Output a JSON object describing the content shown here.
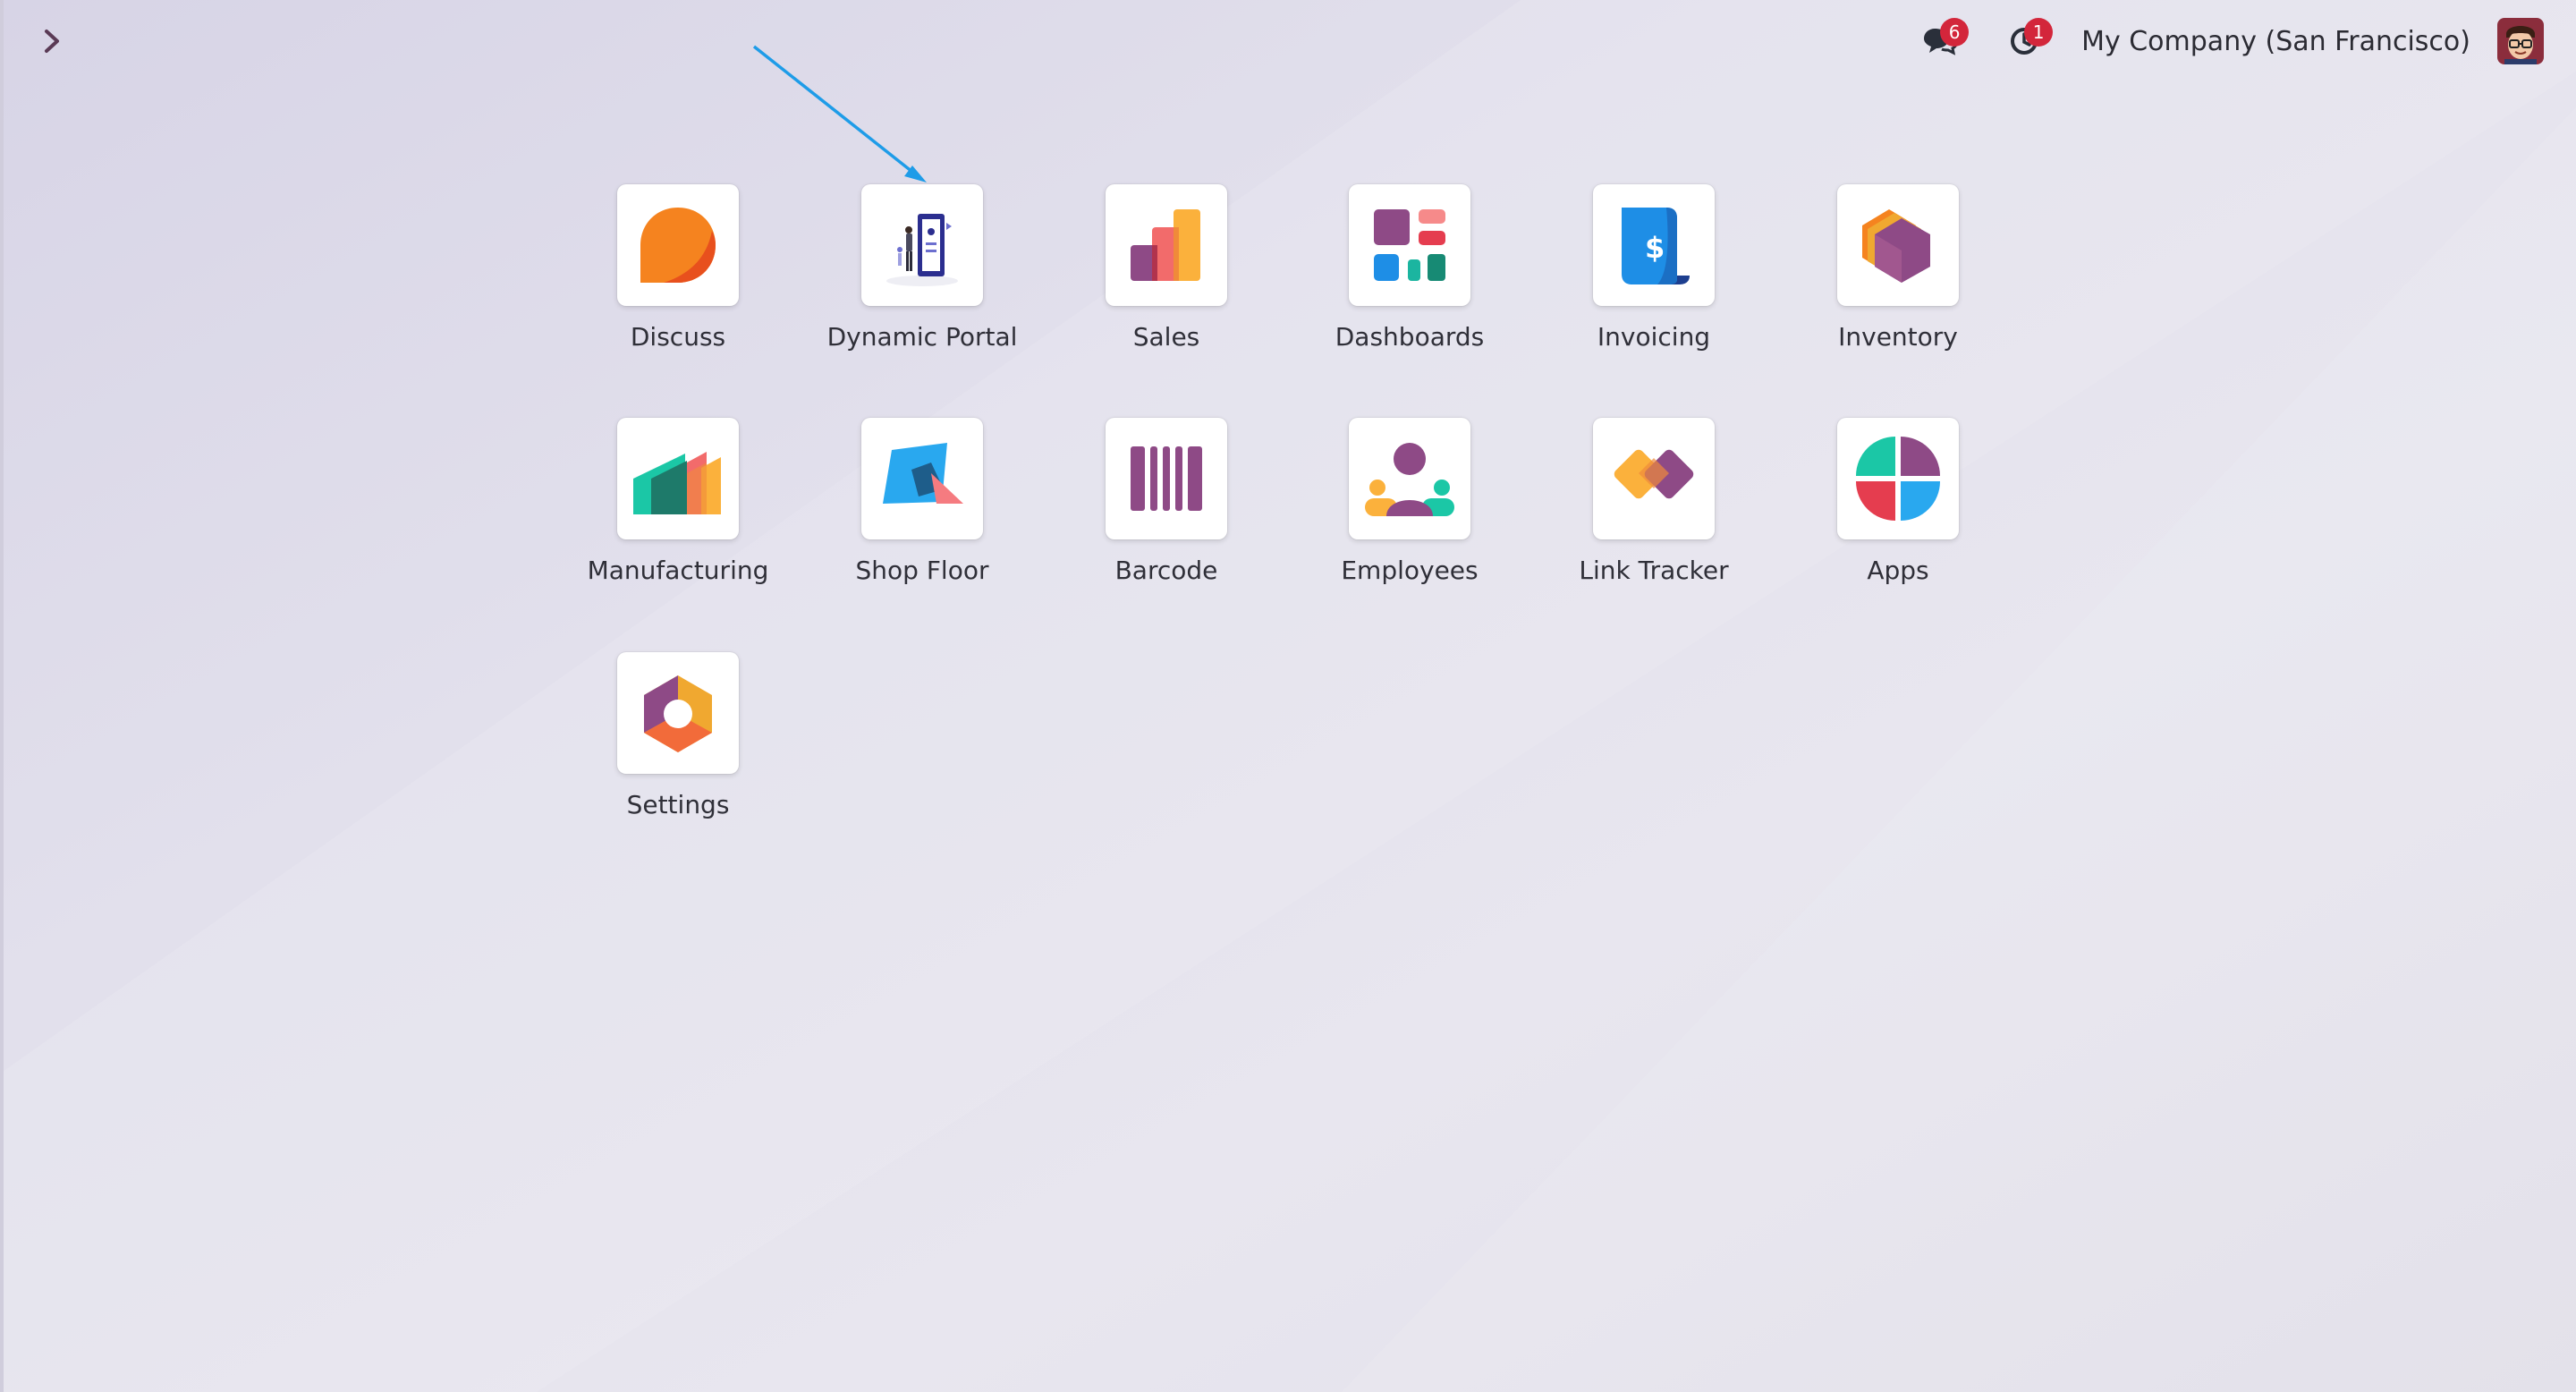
{
  "nav": {
    "toggle_icon": "chevron-right-icon"
  },
  "systray": {
    "messages": {
      "icon": "chat-icon",
      "count": "6"
    },
    "activities": {
      "icon": "clock-icon",
      "count": "1"
    },
    "company": "My Company (San Francisco)",
    "avatar_icon": "user-avatar"
  },
  "colors": {
    "arrow": "#1e9ce8",
    "badge": "#d3263b",
    "text": "#2f2f38"
  },
  "apps": [
    {
      "label": "Discuss",
      "icon": "discuss-icon"
    },
    {
      "label": "Dynamic Portal",
      "icon": "dynamic-portal-icon"
    },
    {
      "label": "Sales",
      "icon": "sales-icon"
    },
    {
      "label": "Dashboards",
      "icon": "dashboards-icon"
    },
    {
      "label": "Invoicing",
      "icon": "invoicing-icon"
    },
    {
      "label": "Inventory",
      "icon": "inventory-icon"
    },
    {
      "label": "Manufacturing",
      "icon": "manufacturing-icon"
    },
    {
      "label": "Shop Floor",
      "icon": "shop-floor-icon"
    },
    {
      "label": "Barcode",
      "icon": "barcode-icon"
    },
    {
      "label": "Employees",
      "icon": "employees-icon"
    },
    {
      "label": "Link Tracker",
      "icon": "link-tracker-icon"
    },
    {
      "label": "Apps",
      "icon": "apps-icon"
    },
    {
      "label": "Settings",
      "icon": "settings-icon"
    }
  ]
}
